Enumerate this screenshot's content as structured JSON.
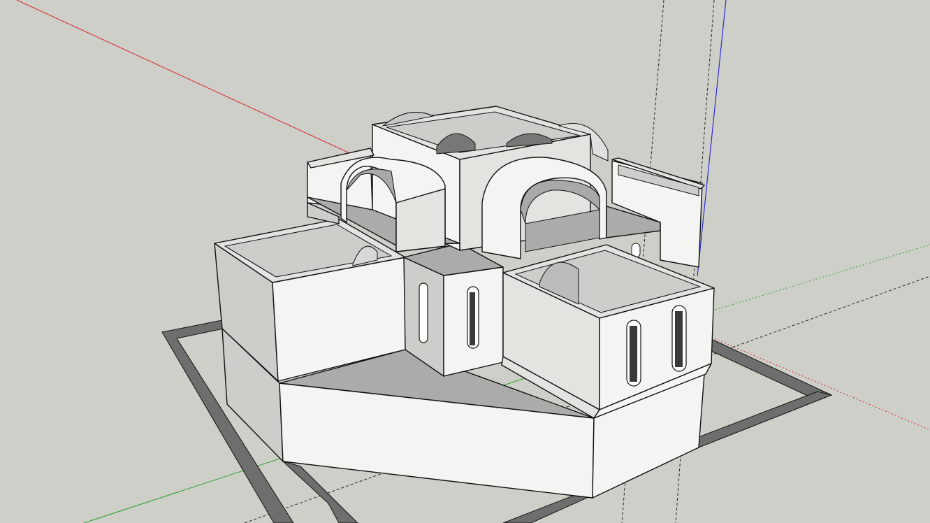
{
  "app": {
    "kind": "3d-modeling-viewport"
  },
  "scene": {
    "background": "#cfcfca",
    "axis_colors": {
      "red": "#d42a2a",
      "green": "#2aa02a",
      "blue": "#2a2ad4"
    },
    "guide_line_color": "#222222",
    "model": "building-with-vaulted-arches"
  }
}
